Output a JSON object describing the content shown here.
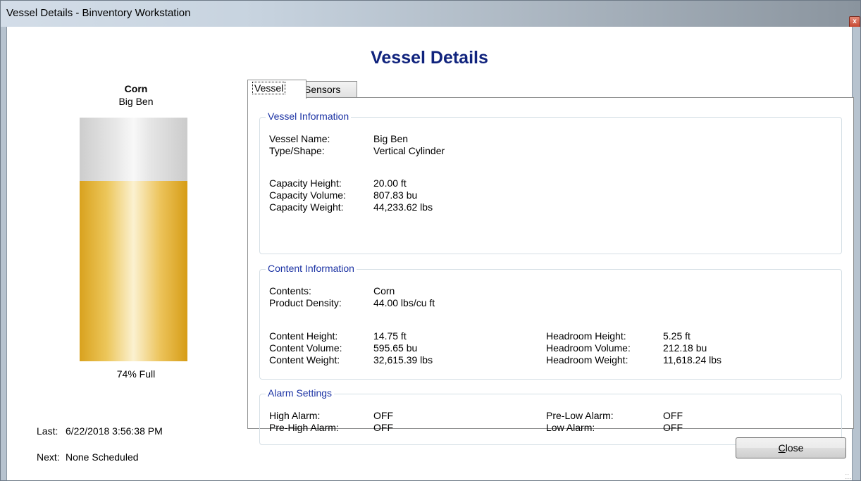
{
  "window": {
    "title": "Vessel Details - Binventory Workstation",
    "close_glyph": "x"
  },
  "page_title": "Vessel Details",
  "left": {
    "content": "Corn",
    "vessel": "Big Ben",
    "fill_fraction": 0.74,
    "fill_color": "#e3b23c",
    "empty_color": "#e0e0e0",
    "percent_label": "74% Full",
    "last_label": "Last:",
    "last_value": "6/22/2018 3:56:38 PM",
    "next_label": "Next:",
    "next_value": "None Scheduled"
  },
  "tabs": [
    {
      "label": "Vessel",
      "active": true
    },
    {
      "label": "Sensors",
      "active": false
    }
  ],
  "vessel_info": {
    "title": "Vessel Information",
    "name_label": "Vessel Name:",
    "name_value": "Big Ben",
    "type_label": "Type/Shape:",
    "type_value": "Vertical Cylinder",
    "cap_height_label": "Capacity Height:",
    "cap_height_value": "20.00 ft",
    "cap_volume_label": "Capacity Volume:",
    "cap_volume_value": "807.83 bu",
    "cap_weight_label": "Capacity Weight:",
    "cap_weight_value": "44,233.62 lbs"
  },
  "content_info": {
    "title": "Content Information",
    "contents_label": "Contents:",
    "contents_value": "Corn",
    "density_label": "Product Density:",
    "density_value": "44.00 lbs/cu ft",
    "content_height_label": "Content Height:",
    "content_height_value": "14.75 ft",
    "content_volume_label": "Content Volume:",
    "content_volume_value": "595.65 bu",
    "content_weight_label": "Content Weight:",
    "content_weight_value": "32,615.39 lbs",
    "headroom_height_label": "Headroom Height:",
    "headroom_height_value": "5.25 ft",
    "headroom_volume_label": "Headroom Volume:",
    "headroom_volume_value": "212.18 bu",
    "headroom_weight_label": "Headroom Weight:",
    "headroom_weight_value": "11,618.24 lbs"
  },
  "alarm_settings": {
    "title": "Alarm Settings",
    "high_label": "High Alarm:",
    "high_value": "OFF",
    "prehigh_label": "Pre-High Alarm:",
    "prehigh_value": "OFF",
    "prelow_label": "Pre-Low Alarm:",
    "prelow_value": "OFF",
    "low_label": "Low Alarm:",
    "low_value": "OFF"
  },
  "close_button": {
    "label_underlined": "C",
    "label_rest": "lose"
  }
}
